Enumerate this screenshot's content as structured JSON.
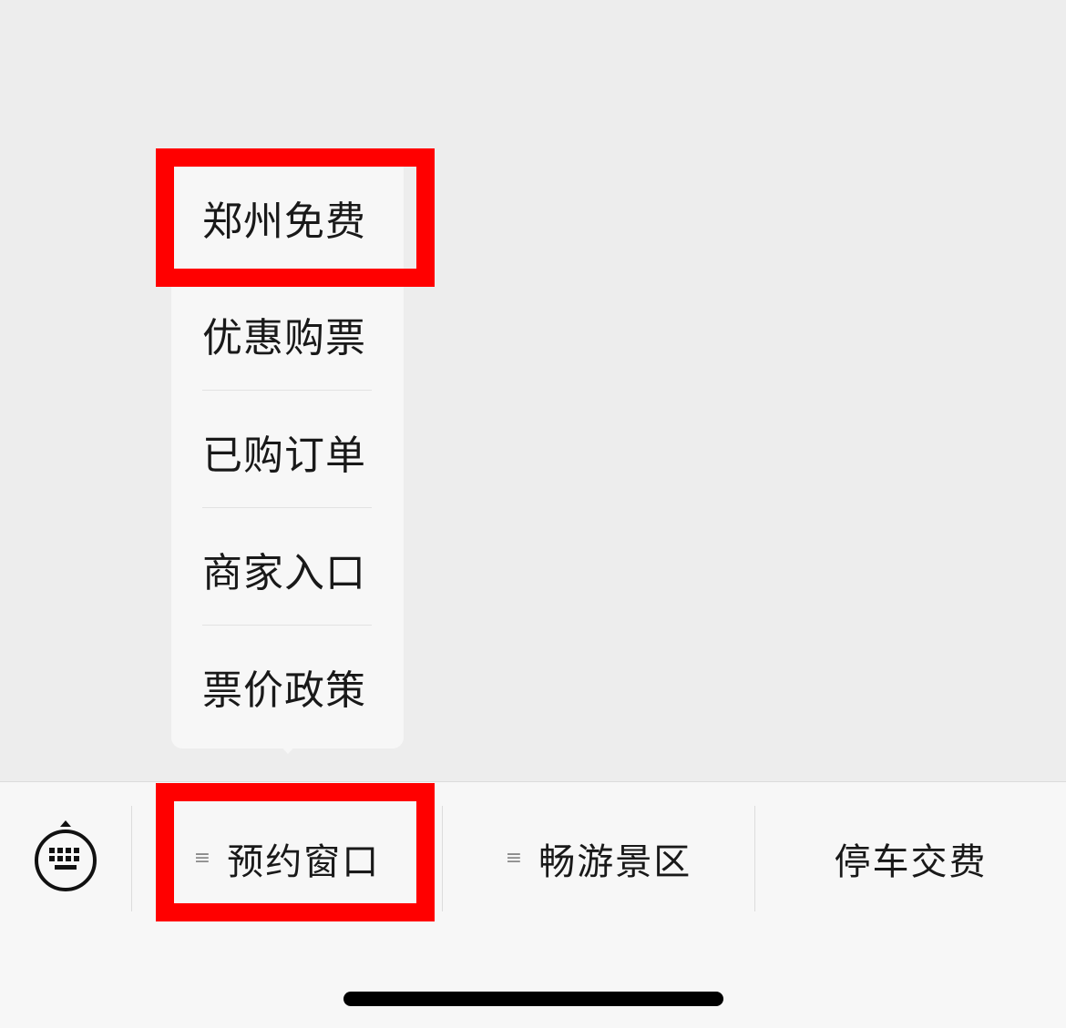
{
  "submenu": {
    "items": [
      {
        "label": "郑州免费"
      },
      {
        "label": "优惠购票"
      },
      {
        "label": "已购订单"
      },
      {
        "label": "商家入口"
      },
      {
        "label": "票价政策"
      }
    ]
  },
  "bottom_bar": {
    "keyboard_icon": "keyboard-icon",
    "submenu_glyph": "≡",
    "tabs": [
      {
        "label": "预约窗口",
        "has_submenu": true
      },
      {
        "label": "畅游景区",
        "has_submenu": true
      },
      {
        "label": "停车交费",
        "has_submenu": false
      }
    ]
  },
  "colors": {
    "highlight": "#ff0000",
    "background": "#ededed",
    "menu_background": "#f7f7f7",
    "text": "#191919"
  }
}
